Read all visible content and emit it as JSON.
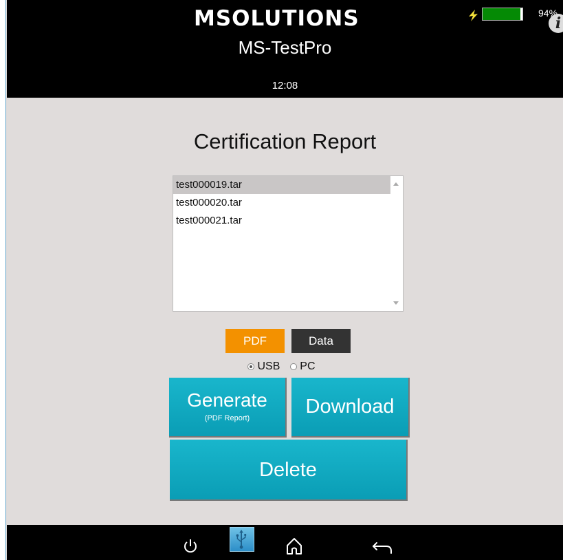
{
  "header": {
    "logo_text": "MSOLUTIONS",
    "app_title": "MS-TestPro",
    "time": "12:08",
    "battery_percent_label": "94%",
    "battery_level": 0.94,
    "charging_icon": "lightning-icon",
    "info_icon": "info-icon",
    "info_label": "i"
  },
  "main": {
    "page_title": "Certification Report",
    "files": [
      {
        "name": "test000019.tar",
        "selected": true
      },
      {
        "name": "test000020.tar",
        "selected": false
      },
      {
        "name": "test000021.tar",
        "selected": false
      }
    ],
    "format_tabs": {
      "pdf": "PDF",
      "data": "Data"
    },
    "destination": {
      "usb": "USB",
      "pc": "PC",
      "selected": "USB"
    },
    "buttons": {
      "generate": "Generate",
      "generate_sub": "(PDF Report)",
      "download": "Download",
      "delete": "Delete"
    }
  },
  "nav": {
    "icons": [
      "power-icon",
      "usb-icon",
      "home-icon",
      "back-icon"
    ]
  },
  "colors": {
    "accent_pdf": "#f39100",
    "data_tab": "#333333",
    "action_button": "#0aa6c0",
    "battery": "#058a05",
    "background": "#e0dcdb"
  }
}
